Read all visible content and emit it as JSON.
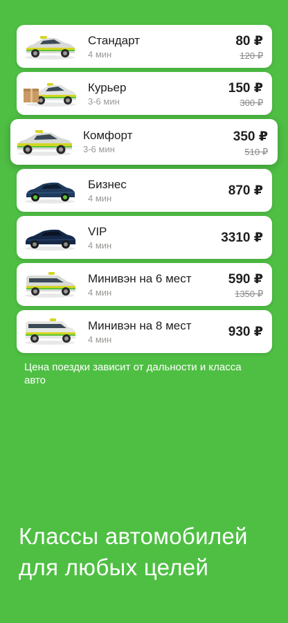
{
  "tariffs": [
    {
      "name": "Стандарт",
      "eta": "4 мин",
      "price": "80 ₽",
      "old_price": "120 ₽",
      "car": "taxi-sedan-icon",
      "body_color": "#d9dad7",
      "stripe_color": "#d4d624"
    },
    {
      "name": "Курьер",
      "eta": "3-6 мин",
      "price": "150 ₽",
      "old_price": "300 ₽",
      "car": "courier-car-with-box-icon",
      "body_color": "#e2e3e0",
      "stripe_color": "#d4d624"
    },
    {
      "name": "Комфорт",
      "eta": "3-6 мин",
      "price": "350 ₽",
      "old_price": "510 ₽",
      "car": "comfort-taxi-icon",
      "body_color": "#d6d8d4",
      "stripe_color": "#d4d624"
    },
    {
      "name": "Бизнес",
      "eta": "4 мин",
      "price": "870 ₽",
      "old_price": "",
      "car": "business-sedan-icon",
      "body_color": "#1f3a5c",
      "stripe_color": ""
    },
    {
      "name": "VIP",
      "eta": "4 мин",
      "price": "3310 ₽",
      "old_price": "",
      "car": "vip-sedan-icon",
      "body_color": "#152848",
      "stripe_color": ""
    },
    {
      "name": "Минивэн на 6 мест",
      "eta": "4 мин",
      "price": "590 ₽",
      "old_price": "1350 ₽",
      "car": "minivan-icon",
      "body_color": "#d9dad7",
      "stripe_color": "#d4d624"
    },
    {
      "name": "Минивэн на 8 мест",
      "eta": "4 мин",
      "price": "930 ₽",
      "old_price": "",
      "car": "minibus-icon",
      "body_color": "#e6e7e4",
      "stripe_color": "#d4d624"
    }
  ],
  "selected_index": 2,
  "note": "Цена поездки зависит от дальности и класса авто",
  "headline": "Классы автомобилей для любых целей",
  "colors": {
    "background": "#4fbf44",
    "card": "#ffffff",
    "brand_green": "#5ac43a"
  }
}
